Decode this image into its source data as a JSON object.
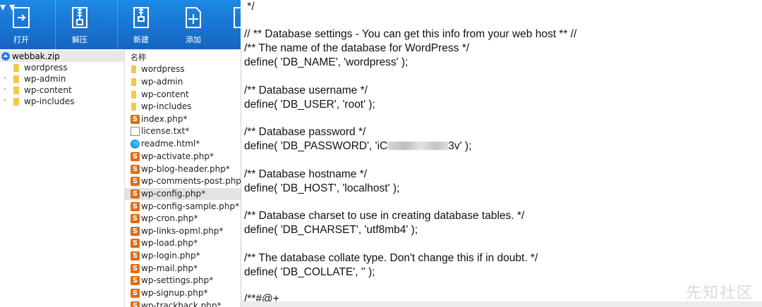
{
  "toolbar": {
    "buttons": [
      {
        "label": "打开",
        "icon": "open-icon"
      },
      {
        "label": "解压",
        "icon": "extract-icon"
      },
      {
        "label": "新建",
        "icon": "new-archive-icon"
      },
      {
        "label": "添加",
        "icon": "add-icon"
      }
    ]
  },
  "tree": {
    "root": "webbak.zip",
    "items": [
      "wordpress",
      "wp-admin",
      "wp-content",
      "wp-includes"
    ]
  },
  "files": {
    "header": "名称",
    "items": [
      {
        "name": "wordpress",
        "type": "folder"
      },
      {
        "name": "wp-admin",
        "type": "folder"
      },
      {
        "name": "wp-content",
        "type": "folder"
      },
      {
        "name": "wp-includes",
        "type": "folder"
      },
      {
        "name": "index.php*",
        "type": "php"
      },
      {
        "name": "license.txt*",
        "type": "txt"
      },
      {
        "name": "readme.html*",
        "type": "html"
      },
      {
        "name": "wp-activate.php*",
        "type": "php"
      },
      {
        "name": "wp-blog-header.php*",
        "type": "php"
      },
      {
        "name": "wp-comments-post.php*",
        "type": "php"
      },
      {
        "name": "wp-config.php*",
        "type": "php",
        "selected": true
      },
      {
        "name": "wp-config-sample.php*",
        "type": "php"
      },
      {
        "name": "wp-cron.php*",
        "type": "php"
      },
      {
        "name": "wp-links-opml.php*",
        "type": "php"
      },
      {
        "name": "wp-load.php*",
        "type": "php"
      },
      {
        "name": "wp-login.php*",
        "type": "php"
      },
      {
        "name": "wp-mail.php*",
        "type": "php"
      },
      {
        "name": "wp-settings.php*",
        "type": "php"
      },
      {
        "name": "wp-signup.php*",
        "type": "php"
      },
      {
        "name": "wp-trackback.php*",
        "type": "php"
      }
    ]
  },
  "code": {
    "l0": " */",
    "l1": "// ** Database settings - You can get this info from your web host ** //",
    "l2": "/** The name of the database for WordPress */",
    "l3": "define( 'DB_NAME', 'wordpress' );",
    "l4": "/** Database username */",
    "l5": "define( 'DB_USER', 'root' );",
    "l6": "/** Database password */",
    "l7a": "define( 'DB_PASSWORD', 'iC",
    "l7b": "3v' );",
    "l8": "/** Database hostname */",
    "l9": "define( 'DB_HOST', 'localhost' );",
    "l10": "/** Database charset to use in creating database tables. */",
    "l11": "define( 'DB_CHARSET', 'utf8mb4' );",
    "l12": "/** The database collate type. Don't change this if in doubt. */",
    "l13": "define( 'DB_COLLATE', '' );",
    "l14": "/**#@+"
  },
  "watermark": "先知社区",
  "colors": {
    "toolbar": "#1565c0",
    "php_icon": "#e26c12",
    "folder": "#f2c94c"
  }
}
